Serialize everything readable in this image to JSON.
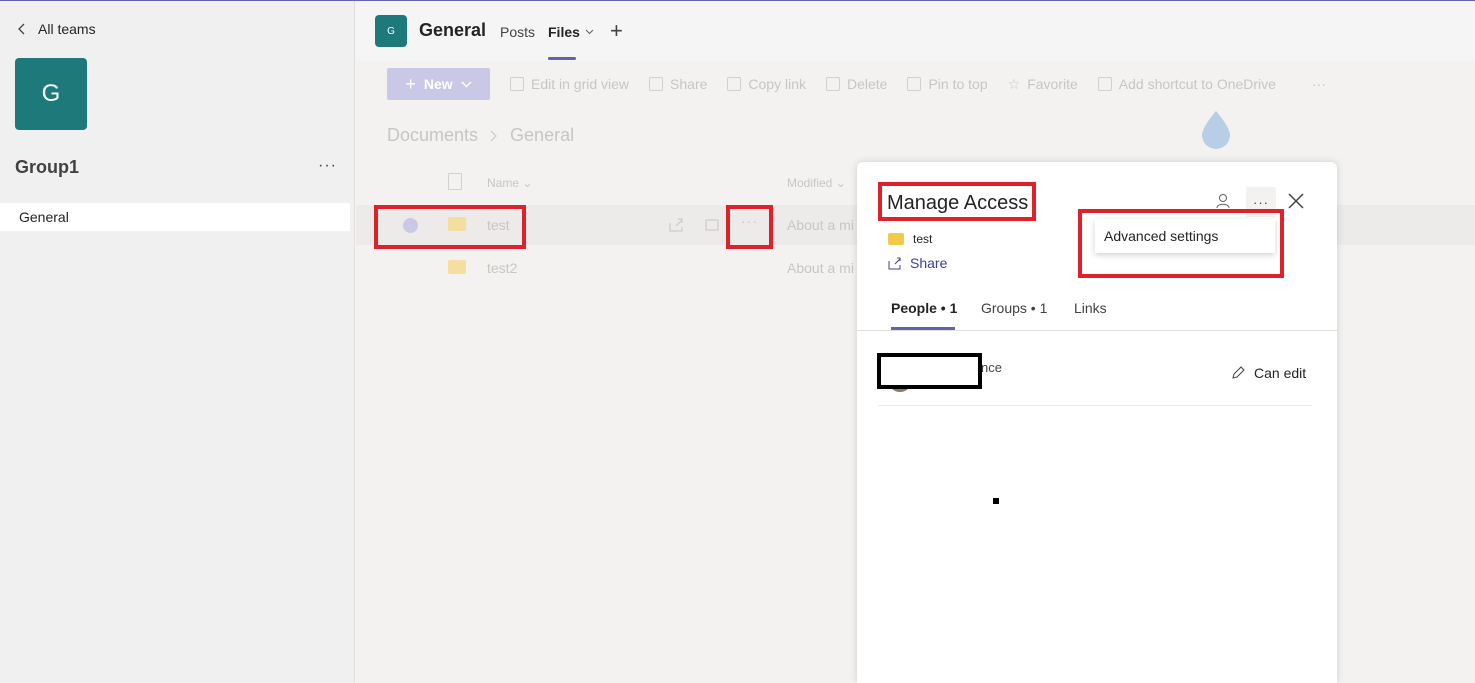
{
  "left_pane": {
    "back_label": "All teams",
    "team_initial": "G",
    "team_name": "Group1",
    "more_label": "···",
    "channels": [
      {
        "label": "General"
      }
    ]
  },
  "header": {
    "channel_initial": "G",
    "channel_title": "General",
    "tabs": [
      {
        "label": "Posts"
      },
      {
        "label": "Files"
      }
    ],
    "add_tab_label": "+"
  },
  "toolbar": {
    "new_label": "New",
    "items": [
      {
        "label": "Edit in grid view",
        "icon": "grid-icon"
      },
      {
        "label": "Share",
        "icon": "share-icon"
      },
      {
        "label": "Copy link",
        "icon": "link-icon"
      },
      {
        "label": "Delete",
        "icon": "trash-icon"
      },
      {
        "label": "Pin to top",
        "icon": "pin-icon"
      },
      {
        "label": "Favorite",
        "icon": "star-icon"
      },
      {
        "label": "Add shortcut to OneDrive",
        "icon": "shortcut-icon"
      }
    ],
    "more_label": "···"
  },
  "breadcrumb": [
    "Documents",
    "General"
  ],
  "file_list": {
    "columns": {
      "name": "Name",
      "modified": "Modified"
    },
    "rows": [
      {
        "name": "test",
        "modified": "About a mi",
        "more_label": "···"
      },
      {
        "name": "test2",
        "modified": "About a mi"
      }
    ]
  },
  "manage_access": {
    "title": "Manage Access",
    "item_name": "test",
    "share_label": "Share",
    "more_label": "···",
    "menu_items": [
      {
        "label": "Advanced settings"
      }
    ],
    "tabs": [
      {
        "label": "People • 1"
      },
      {
        "label": "Groups • 1"
      },
      {
        "label": "Links"
      }
    ],
    "people": [
      {
        "name_visible": "nce",
        "permission": "Can edit"
      }
    ]
  },
  "colors": {
    "accent": "#6264a7",
    "team_avatar": "#1e7a7a",
    "annotation_red": "#e0202a"
  }
}
